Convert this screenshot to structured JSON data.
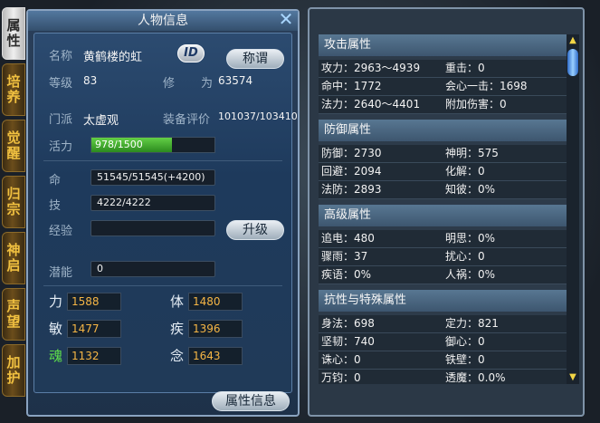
{
  "side_tabs": [
    {
      "label": "属性",
      "active": true
    },
    {
      "label": "培养",
      "active": false
    },
    {
      "label": "觉醒",
      "active": false
    },
    {
      "label": "归宗",
      "active": false
    },
    {
      "label": "神启",
      "active": false
    },
    {
      "label": "声望",
      "active": false
    },
    {
      "label": "加护",
      "active": false
    }
  ],
  "panel": {
    "title": "人物信息",
    "close_glyph": "✕",
    "name_label": "名称",
    "name_value": "黄鹤楼的虹",
    "id_badge": "ID",
    "title_button": "称谓",
    "level_label": "等级",
    "level_value": "83",
    "cultivation_label_1": "修",
    "cultivation_label_2": "为",
    "cultivation_value": "63574",
    "sect_label": "门派",
    "sect_value": "太虚观",
    "equip_label": "装备评价",
    "equip_value": "101037/103410",
    "vitality_label": "活力",
    "vitality_value": "978/1500",
    "vitality_fraction": 0.652,
    "hp_label": "命",
    "hp_value": "51545/51545(+4200)",
    "skill_label": "技",
    "skill_value": "4222/4222",
    "exp_label": "经验",
    "exp_value": "",
    "upgrade_button": "升级",
    "potential_label": "潜能",
    "potential_value": "0",
    "stats": [
      {
        "name": "力",
        "value": "1588",
        "green": false
      },
      {
        "name": "体",
        "value": "1480",
        "green": false
      },
      {
        "name": "敏",
        "value": "1477",
        "green": false
      },
      {
        "name": "疾",
        "value": "1396",
        "green": false
      },
      {
        "name": "魂",
        "value": "1132",
        "green": true
      },
      {
        "name": "念",
        "value": "1643",
        "green": false
      }
    ],
    "attr_info_button": "属性信息"
  },
  "attributes": {
    "sections": [
      {
        "title": "攻击属性",
        "rows": [
          [
            "攻力：2963～4939",
            "重击：0"
          ],
          [
            "命中：1772",
            "会心一击：1698"
          ],
          [
            "法力：2640～4401",
            "附加伤害：0"
          ]
        ]
      },
      {
        "title": "防御属性",
        "rows": [
          [
            "防御：2730",
            "神明：575"
          ],
          [
            "回避：2094",
            "化解：0"
          ],
          [
            "法防：2893",
            "知彼：0%"
          ]
        ]
      },
      {
        "title": "高级属性",
        "rows": [
          [
            "追电：480",
            "明思：0%"
          ],
          [
            "骤雨：37",
            "扰心：0"
          ],
          [
            "疾语：0%",
            "人祸：0%"
          ]
        ]
      },
      {
        "title": "抗性与特殊属性",
        "rows": [
          [
            "身法：698",
            "定力：821"
          ],
          [
            "坚韧：740",
            "御心：0"
          ],
          [
            "诛心：0",
            "铁壁：0"
          ],
          [
            "万钧：0",
            "透魔：0.0%"
          ]
        ]
      }
    ],
    "scroll_up": "▲",
    "scroll_down": "▼"
  }
}
